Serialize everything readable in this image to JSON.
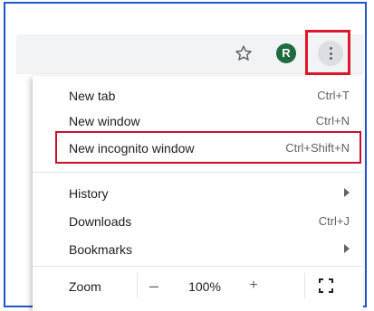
{
  "toolbar": {
    "avatar_letter": "R"
  },
  "menu": {
    "items": [
      {
        "label": "New tab",
        "shortcut": "Ctrl+T"
      },
      {
        "label": "New window",
        "shortcut": "Ctrl+N"
      },
      {
        "label": "New incognito window",
        "shortcut": "Ctrl+Shift+N"
      },
      {
        "label": "History",
        "shortcut": ""
      },
      {
        "label": "Downloads",
        "shortcut": "Ctrl+J"
      },
      {
        "label": "Bookmarks",
        "shortcut": ""
      }
    ],
    "zoom": {
      "label": "Zoom",
      "minus": "–",
      "value": "100%",
      "plus": "+"
    }
  },
  "colors": {
    "frame_border": "#1f56c8",
    "highlight_red": "#e0182d",
    "avatar_bg": "#1e6b3f",
    "toolbar_bg": "#f1f3f4"
  },
  "icons": {
    "star": "star-icon",
    "kebab": "more-vert-icon",
    "submenu_arrow": "chevron-right-icon",
    "fullscreen": "fullscreen-icon"
  }
}
